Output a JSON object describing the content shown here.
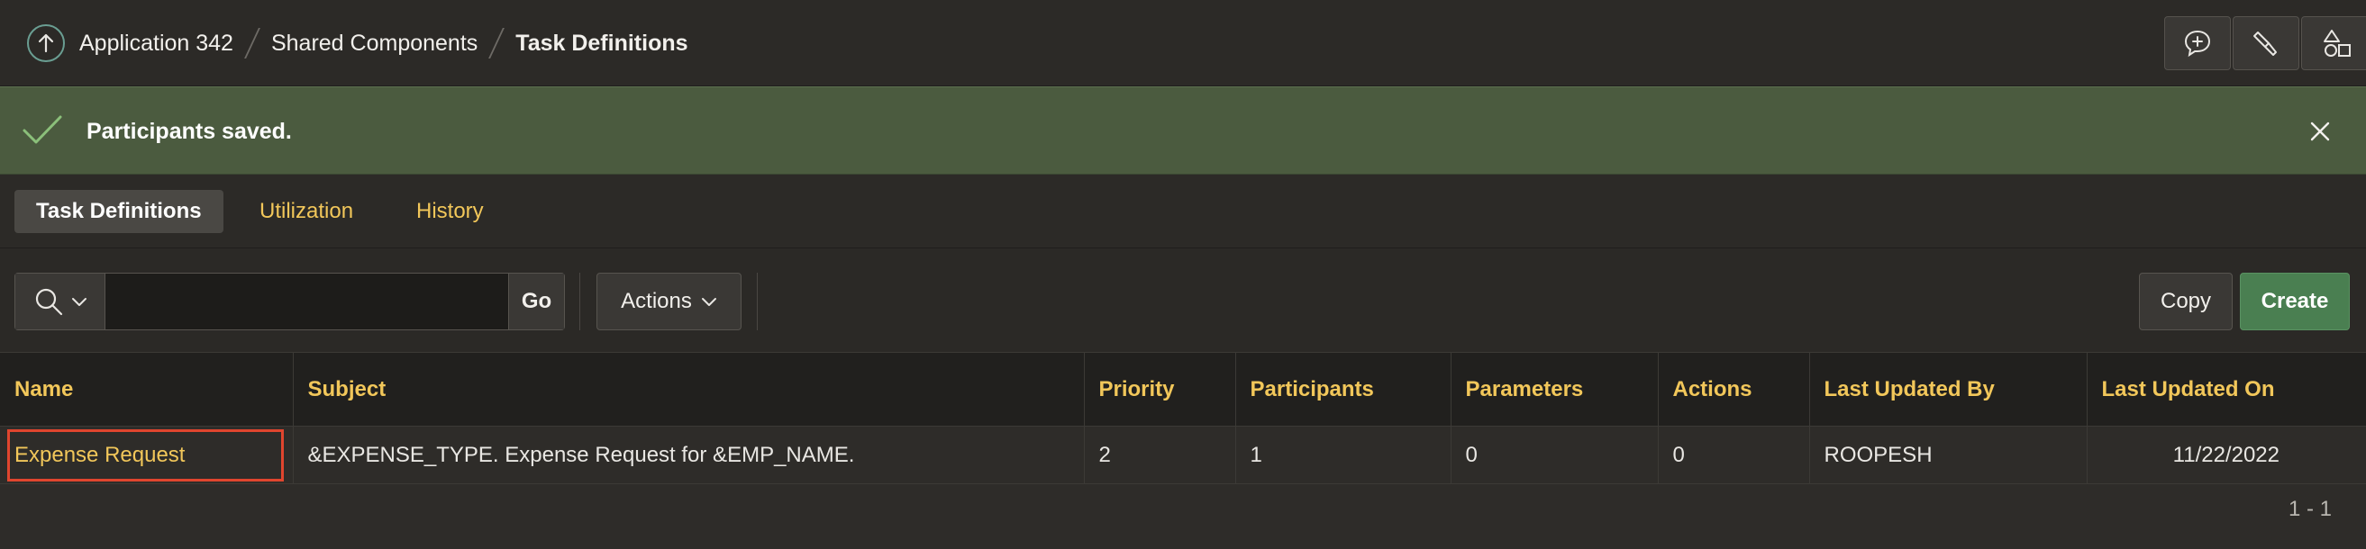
{
  "breadcrumb": {
    "items": [
      "Application 342",
      "Shared Components",
      "Task Definitions"
    ]
  },
  "header_tools": [
    "add-comment-icon",
    "highlighter-icon",
    "shapes-icon"
  ],
  "message": {
    "text": "Participants saved.",
    "color": "#4b5b3f"
  },
  "tabs": [
    {
      "label": "Task Definitions",
      "active": true
    },
    {
      "label": "Utilization",
      "active": false
    },
    {
      "label": "History",
      "active": false
    }
  ],
  "toolbar": {
    "search_value": "",
    "go_label": "Go",
    "actions_label": "Actions",
    "copy_label": "Copy",
    "create_label": "Create",
    "create_color": "#4a7f51"
  },
  "table": {
    "columns": [
      "Name",
      "Subject",
      "Priority",
      "Participants",
      "Parameters",
      "Actions",
      "Last Updated By",
      "Last Updated On"
    ],
    "rows": [
      {
        "name": "Expense Request",
        "subject": "&EXPENSE_TYPE. Expense Request for &EMP_NAME.",
        "priority": "2",
        "participants": "1",
        "parameters": "0",
        "actions": "0",
        "last_updated_by": "ROOPESH",
        "last_updated_on": "11/22/2022"
      }
    ]
  },
  "pagination": "1 - 1",
  "accent_color": "#f2c75a",
  "highlight_color": "#e0452e"
}
